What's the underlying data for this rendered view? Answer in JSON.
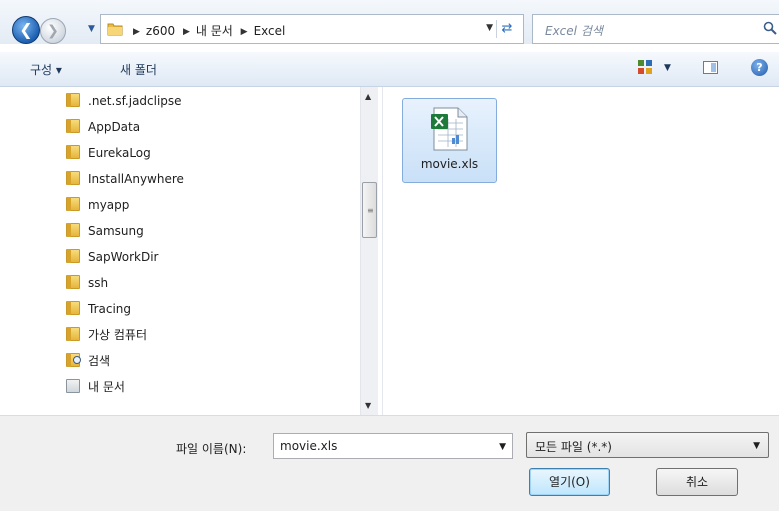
{
  "address_bar": {
    "breadcrumb": [
      "z600",
      "내 문서",
      "Excel"
    ],
    "search_placeholder": "Excel 검색"
  },
  "command_bar": {
    "organize_label": "구성 ▾",
    "new_folder_label": "새 폴더"
  },
  "nav_pane": {
    "items": [
      {
        "label": ".net.sf.jadclipse",
        "icon": "folder-icon"
      },
      {
        "label": "AppData",
        "icon": "folder-icon"
      },
      {
        "label": "EurekaLog",
        "icon": "folder-icon"
      },
      {
        "label": "InstallAnywhere",
        "icon": "folder-icon"
      },
      {
        "label": "myapp",
        "icon": "folder-icon"
      },
      {
        "label": "Samsung",
        "icon": "folder-icon"
      },
      {
        "label": "SapWorkDir",
        "icon": "folder-icon"
      },
      {
        "label": "ssh",
        "icon": "folder-icon"
      },
      {
        "label": "Tracing",
        "icon": "folder-icon"
      },
      {
        "label": "가상 컴퓨터",
        "icon": "folder-icon"
      },
      {
        "label": "검색",
        "icon": "search-folder-icon"
      },
      {
        "label": "내 문서",
        "icon": "documents-icon"
      }
    ]
  },
  "file_list": {
    "files": [
      {
        "name": "movie.xls",
        "icon": "excel-file-icon",
        "selected": true
      }
    ]
  },
  "bottom": {
    "file_name_label": "파일 이름(N):",
    "file_name_value": "movie.xls",
    "file_type_value": "모든 파일 (*.*)",
    "open_label": "열기(O)",
    "cancel_label": "취소"
  },
  "colors": {
    "accent": "#1d5fb0",
    "selection": "#c9e0f7",
    "folder": "#e6b53c"
  }
}
